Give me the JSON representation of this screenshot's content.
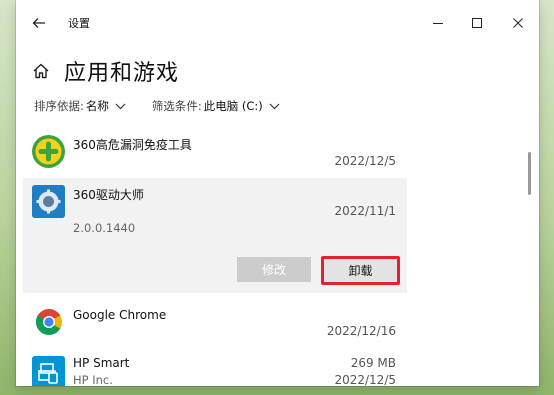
{
  "window": {
    "title": "设置"
  },
  "page": {
    "title": "应用和游戏"
  },
  "filters": {
    "sort_label": "排序依据:",
    "sort_value": "名称",
    "filter_label": "筛选条件:",
    "filter_value": "此电脑 (C:)"
  },
  "apps": [
    {
      "name": "360高危漏洞免疫工具",
      "date": "2022/12/5",
      "icon": "shield-plus-icon",
      "icon_color": "#3da33a"
    },
    {
      "name": "360驱动大师",
      "date": "2022/11/1",
      "version": "2.0.0.1440",
      "icon": "driver-master-icon",
      "icon_color": "#1f7fc4",
      "buttons": {
        "modify": "修改",
        "uninstall": "卸载"
      }
    },
    {
      "name": "Google Chrome",
      "date": "2022/12/16",
      "icon": "chrome-icon"
    },
    {
      "name": "HP Smart",
      "publisher": "HP Inc.",
      "size": "269 MB",
      "date": "2022/12/5",
      "icon": "hp-smart-icon",
      "icon_color": "#0096d6"
    }
  ],
  "colors": {
    "highlight_border": "#e0232c",
    "expanded_bg": "#f2f2f2"
  }
}
